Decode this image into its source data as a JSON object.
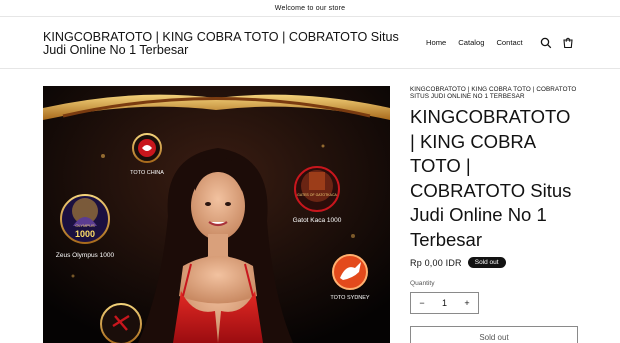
{
  "announcement": "Welcome to our store",
  "header": {
    "logo_text": "KINGCOBRATOTO | KING COBRA TOTO | COBRATOTO Situs Judi Online No 1 Terbesar",
    "nav": [
      "Home",
      "Catalog",
      "Contact"
    ],
    "icons": [
      "search-icon",
      "cart-icon"
    ]
  },
  "media": {
    "badges": [
      {
        "label": "TOTO CHINA"
      },
      {
        "label": "Gatot Kaca 1000"
      },
      {
        "label": "Zeus Olympus 1000"
      },
      {
        "label": "TOTO SYDNEY"
      }
    ],
    "gate_text": "GATES OF GATOTKACA",
    "olympus_text": "OLYMPUS",
    "olympus_number": "1000"
  },
  "product": {
    "vendor": "KINGCOBRATOTO | KING COBRA TOTO | COBRATOTO SITUS JUDI ONLINE NO 1 TERBESAR",
    "title": "KINGCOBRATOTO | KING COBRA TOTO | COBRATOTO Situs Judi Online No 1 Terbesar",
    "price": "Rp 0,00 IDR",
    "badge": "Sold out",
    "quantity_label": "Quantity",
    "quantity_value": "1",
    "minus": "−",
    "plus": "+",
    "soldout_button": "Sold out"
  },
  "colors": {
    "text": "#121212",
    "border": "#8a8a8a",
    "badge_bg": "#121212",
    "accent_gold": "#d9a441",
    "accent_red": "#c8161d"
  }
}
